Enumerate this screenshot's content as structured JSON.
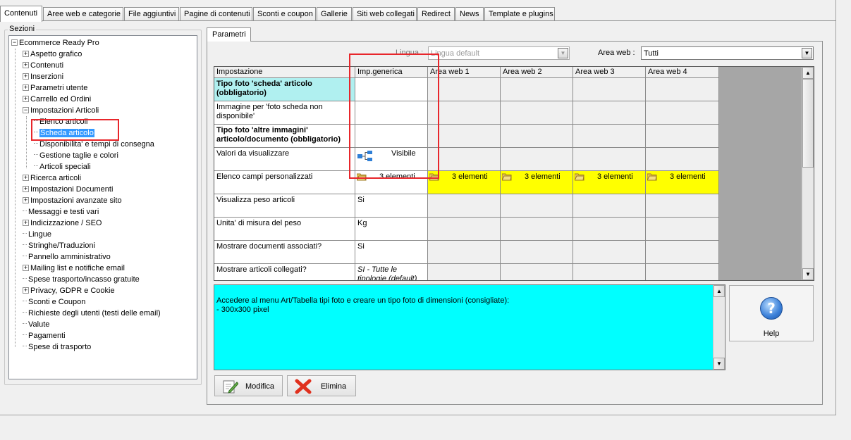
{
  "top_tabs": [
    {
      "label": "Contenuti",
      "active": true
    },
    {
      "label": "Aree web e categorie"
    },
    {
      "label": "File aggiuntivi"
    },
    {
      "label": "Pagine di contenuti"
    },
    {
      "label": "Sconti e coupon"
    },
    {
      "label": "Gallerie"
    },
    {
      "label": "Siti web collegati"
    },
    {
      "label": "Redirect"
    },
    {
      "label": "News"
    },
    {
      "label": "Template e plugins"
    }
  ],
  "sections": {
    "label": "Sezioni",
    "root": "Ecommerce Ready Pro",
    "items": [
      {
        "label": "Aspetto grafico"
      },
      {
        "label": "Contenuti"
      },
      {
        "label": "Inserzioni"
      },
      {
        "label": "Parametri utente"
      },
      {
        "label": "Carrello ed Ordini"
      },
      {
        "label": "Impostazioni Articoli"
      },
      {
        "label": "Elenco articoli"
      },
      {
        "label": "Scheda articolo",
        "selected": true
      },
      {
        "label": "Disponibilita' e tempi di consegna"
      },
      {
        "label": "Gestione taglie e colori"
      },
      {
        "label": "Articoli speciali"
      },
      {
        "label": "Ricerca articoli"
      },
      {
        "label": "Impostazioni Documenti"
      },
      {
        "label": "Impostazioni avanzate sito"
      },
      {
        "label": "Messaggi e testi vari"
      },
      {
        "label": "Indicizzazione / SEO"
      },
      {
        "label": "Lingue"
      },
      {
        "label": "Stringhe/Traduzioni"
      },
      {
        "label": "Pannello amministrativo"
      },
      {
        "label": "Mailing list e notifiche email"
      },
      {
        "label": "Spese trasporto/incasso gratuite"
      },
      {
        "label": "Privacy, GDPR e Cookie"
      },
      {
        "label": "Sconti e Coupon"
      },
      {
        "label": "Richieste degli utenti (testi delle email)"
      },
      {
        "label": "Valute"
      },
      {
        "label": "Pagamenti"
      },
      {
        "label": "Spese di trasporto"
      }
    ]
  },
  "params_tab": "Parametri",
  "lingua": {
    "label": "Lingua :",
    "value": "Lingua default"
  },
  "area_web": {
    "label": "Area web :",
    "value": "Tutti"
  },
  "grid": {
    "headers": [
      "Impostazione",
      "Imp.generica",
      "Area web 1",
      "Area web 2",
      "Area web 3",
      "Area web 4"
    ],
    "rows": [
      {
        "name": "Tipo foto 'scheda' articolo (obbligatorio)",
        "generic": "",
        "areas": [
          "",
          "",
          "",
          ""
        ]
      },
      {
        "name": "Immagine per 'foto scheda non disponibile'",
        "generic": "",
        "areas": [
          "",
          "",
          "",
          ""
        ]
      },
      {
        "name": "Tipo foto 'altre immagini' articolo/documento (obbligatorio)",
        "generic": "",
        "areas": [
          "",
          "",
          "",
          ""
        ]
      },
      {
        "name": "Valori da visualizzare",
        "generic": "Visibile",
        "areas": [
          "",
          "",
          "",
          ""
        ]
      },
      {
        "name": "Elenco campi personalizzati",
        "generic": "3 elementi",
        "areas": [
          "3 elementi",
          "3 elementi",
          "3 elementi",
          "3 elementi"
        ]
      },
      {
        "name": "Visualizza peso articoli",
        "generic": "Si",
        "areas": [
          "",
          "",
          "",
          ""
        ]
      },
      {
        "name": "Unita' di misura del peso",
        "generic": "Kg",
        "areas": [
          "",
          "",
          "",
          ""
        ]
      },
      {
        "name": "Mostrare documenti associati?",
        "generic": "Si",
        "areas": [
          "",
          "",
          "",
          ""
        ]
      },
      {
        "name": "Mostrare articoli collegati?",
        "generic": "SI - Tutte le tipologie (default)",
        "areas": [
          "",
          "",
          "",
          ""
        ]
      }
    ]
  },
  "info_text": "Accedere al menu Art/Tabella tipi foto e creare un tipo foto di dimensioni (consigliate):\n- 300x300 pixel",
  "buttons": {
    "help": "Help",
    "modifica": "Modifica",
    "elimina": "Elimina"
  },
  "colors": {
    "highlight_row": "#b0f0f0",
    "yellow": "#ffff00",
    "info_bg": "#00ffff",
    "annotation": "#e8262b"
  }
}
